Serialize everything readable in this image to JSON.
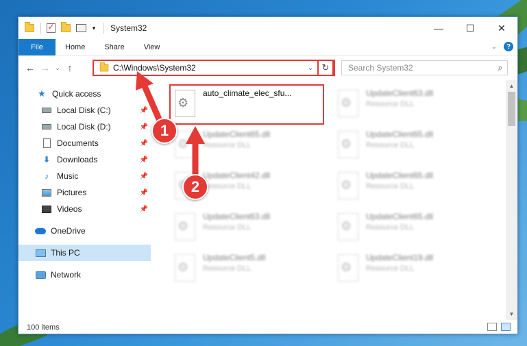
{
  "window": {
    "title": "System32",
    "controls": {
      "minimize": "—",
      "maximize": "☐",
      "close": "✕"
    }
  },
  "ribbon": {
    "tabs": [
      {
        "label": "File"
      },
      {
        "label": "Home"
      },
      {
        "label": "Share"
      },
      {
        "label": "View"
      }
    ],
    "help": "?"
  },
  "navbar": {
    "address": "C:\\Windows\\System32",
    "search_placeholder": "Search System32"
  },
  "sidebar": {
    "items": [
      {
        "label": "Quick access",
        "icon": "star-icon"
      },
      {
        "label": "Local Disk (C:)",
        "icon": "disk-icon",
        "pinned": true
      },
      {
        "label": "Local Disk (D:)",
        "icon": "disk-icon",
        "pinned": true
      },
      {
        "label": "Documents",
        "icon": "document-icon",
        "pinned": true
      },
      {
        "label": "Downloads",
        "icon": "download-icon",
        "pinned": true
      },
      {
        "label": "Music",
        "icon": "music-icon",
        "pinned": true
      },
      {
        "label": "Pictures",
        "icon": "pictures-icon",
        "pinned": true
      },
      {
        "label": "Videos",
        "icon": "video-icon",
        "pinned": true
      },
      {
        "label": "OneDrive",
        "icon": "cloud-icon"
      },
      {
        "label": "This PC",
        "icon": "computer-icon",
        "selected": true
      },
      {
        "label": "Network",
        "icon": "network-icon"
      }
    ]
  },
  "files": {
    "highlighted": {
      "name": "auto_climate_elec_sfu...",
      "type": ""
    },
    "others": [
      {
        "name": "UpdateClient63.dll",
        "type": "Resource DLL"
      },
      {
        "name": "UpdateClient65.dll",
        "type": "Resource DLL"
      },
      {
        "name": "UpdateClient65.dll",
        "type": "Resource DLL"
      },
      {
        "name": "UpdateClient42.dll",
        "type": "Resource DLL"
      },
      {
        "name": "UpdateClient65.dll",
        "type": "Resource DLL"
      },
      {
        "name": "UpdateClient63.dll",
        "type": "Resource DLL"
      },
      {
        "name": "UpdateClient65.dll",
        "type": "Resource DLL"
      },
      {
        "name": "UpdateClient5.dll",
        "type": "Resource DLL"
      },
      {
        "name": "UpdateClient19.dll",
        "type": "Resource DLL"
      }
    ]
  },
  "status": {
    "item_count": "100 items"
  },
  "annotations": {
    "step1": "1",
    "step2": "2",
    "color": "#e53935"
  }
}
